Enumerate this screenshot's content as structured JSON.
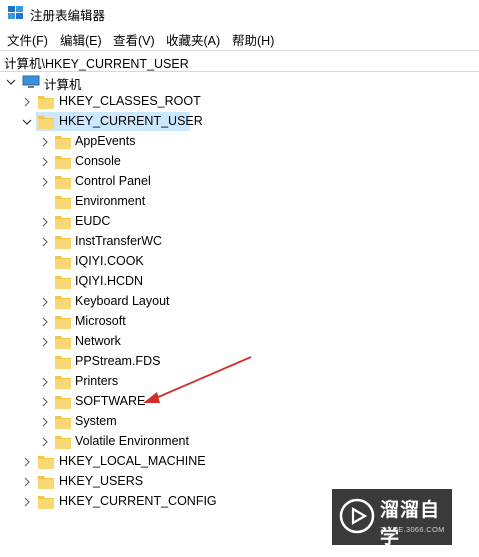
{
  "window": {
    "title": "注册表编辑器"
  },
  "menu": [
    "文件(F)",
    "编辑(E)",
    "查看(V)",
    "收藏夹(A)",
    "帮助(H)"
  ],
  "address": "计算机\\HKEY_CURRENT_USER",
  "tree": {
    "root": "计算机",
    "hkcr": "HKEY_CLASSES_ROOT",
    "hkcu": "HKEY_CURRENT_USER",
    "hkcu_children": [
      "AppEvents",
      "Console",
      "Control Panel",
      "Environment",
      "EUDC",
      "InstTransferWC",
      "IQIYI.COOK",
      "IQIYI.HCDN",
      "Keyboard Layout",
      "Microsoft",
      "Network",
      "PPStream.FDS",
      "Printers",
      "SOFTWARE",
      "System",
      "Volatile Environment"
    ],
    "hklm": "HKEY_LOCAL_MACHINE",
    "hku": "HKEY_USERS",
    "hkcc": "HKEY_CURRENT_CONFIG"
  },
  "watermark": {
    "title": "溜溜自学",
    "subtitle": "ZIXUE.3066.COM"
  },
  "colors": {
    "selection": "#cce8ff",
    "folder": "#f5c54a",
    "annotation_arrow": "#d0302a"
  },
  "icons": {
    "app": "registry-editor-icon",
    "computer": "computer-icon",
    "folder": "folder-icon",
    "expand": "chevron-right-icon",
    "collapse": "chevron-down-icon"
  }
}
